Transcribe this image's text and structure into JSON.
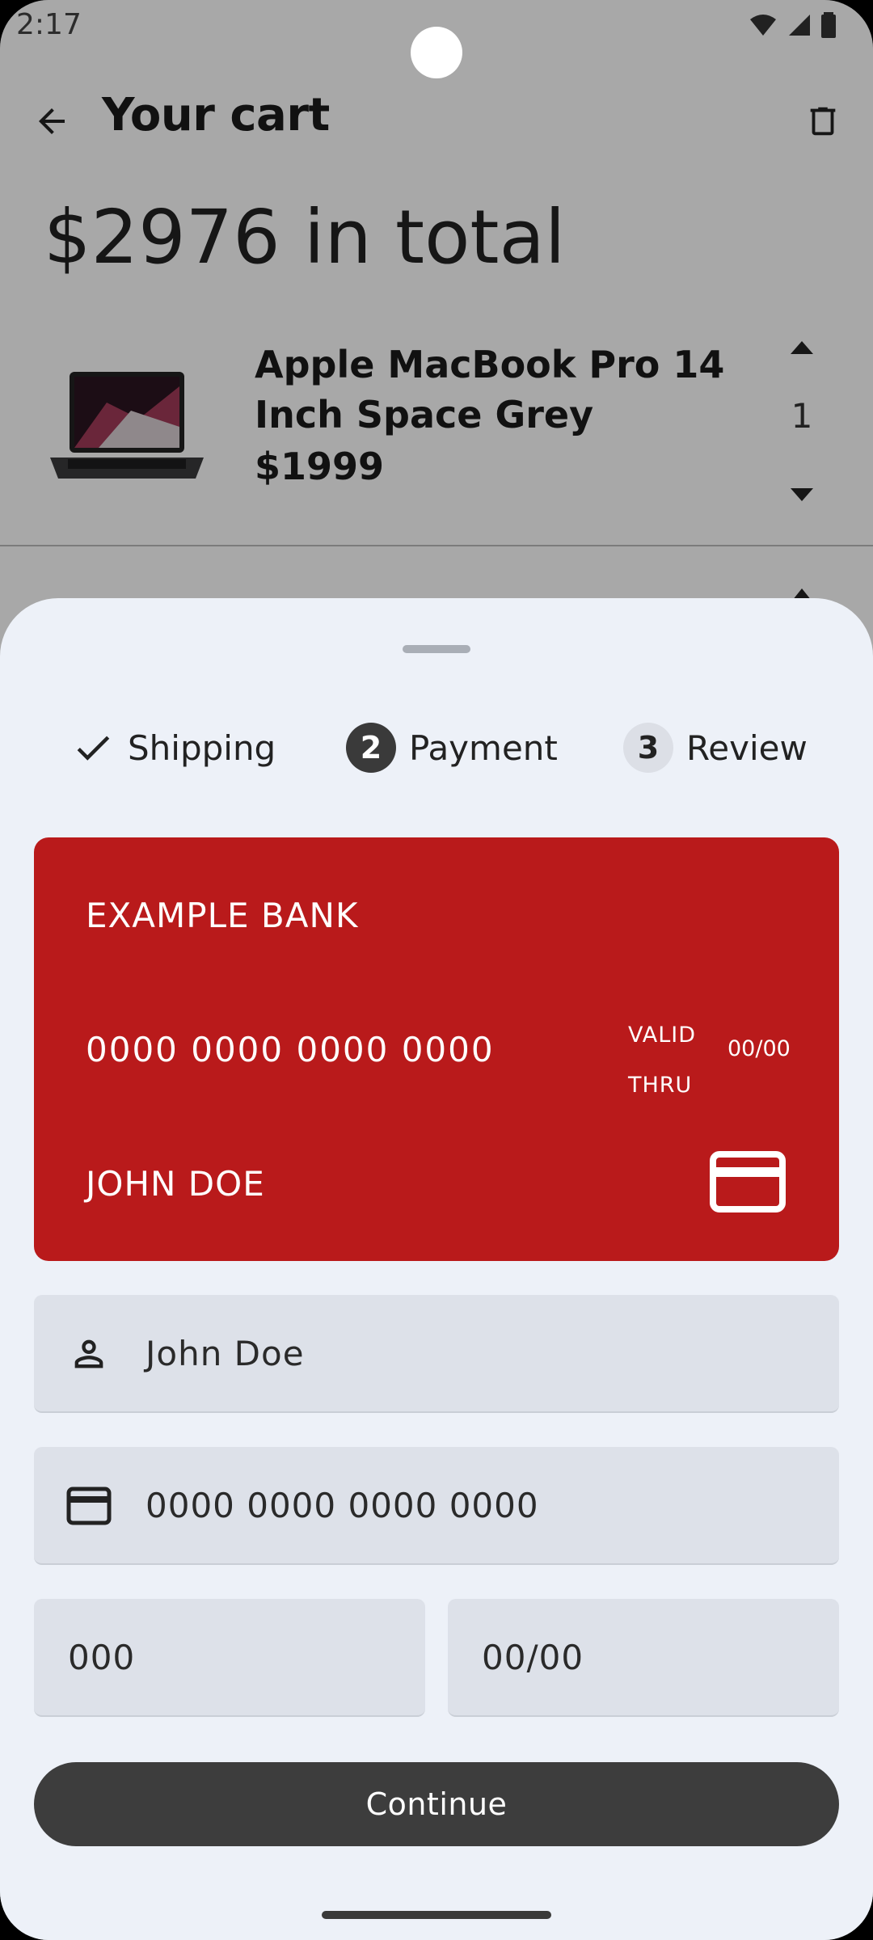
{
  "status_bar": {
    "time": "2:17"
  },
  "appbar": {
    "title": "Your cart"
  },
  "cart": {
    "total": "$2976 in total",
    "items": [
      {
        "name": "Apple MacBook Pro 14 Inch Space Grey",
        "price": "$1999",
        "quantity": "1"
      }
    ]
  },
  "stepper": {
    "steps": [
      {
        "label": "Shipping",
        "state": "done",
        "icon": "check-icon"
      },
      {
        "label": "Payment",
        "state": "active",
        "number": "2"
      },
      {
        "label": "Review",
        "state": "inactive",
        "number": "3"
      }
    ]
  },
  "card_preview": {
    "bank": "EXAMPLE BANK",
    "number": "0000 0000 0000 0000",
    "valid_label": "VALID THRU",
    "expiry": "00/00",
    "holder": "JOHN DOE",
    "color": "#b91a1b"
  },
  "form": {
    "name_placeholder": "John Doe",
    "number_placeholder": "0000 0000 0000 0000",
    "cvv_placeholder": "000",
    "expiry_placeholder": "00/00"
  },
  "actions": {
    "continue_label": "Continue"
  },
  "colors": {
    "sheet_bg": "#edf1f8",
    "field_bg": "#dde1e9",
    "button_bg": "#3d3d3d"
  }
}
